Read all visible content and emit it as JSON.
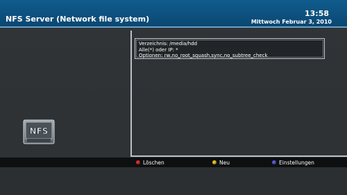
{
  "header": {
    "title": "NFS Server (Network file system)",
    "time": "13:58",
    "date": "Mittwoch Februar 3, 2010"
  },
  "icon": {
    "name": "nfs-icon",
    "text": "NFS"
  },
  "entry": {
    "directory": "Verzeichnis: /media/hdd",
    "hosts": "Alle(*) oder IP: *",
    "options": "Optionen: rw,no_root_squash,sync,no_subtree_check"
  },
  "buttons": {
    "red": {
      "label": "Löschen",
      "color": "#d8302c"
    },
    "yellow": {
      "label": "Neu",
      "color": "#e0c21e"
    },
    "blue": {
      "label": "Einstellungen",
      "color": "#5a5ad0"
    }
  }
}
